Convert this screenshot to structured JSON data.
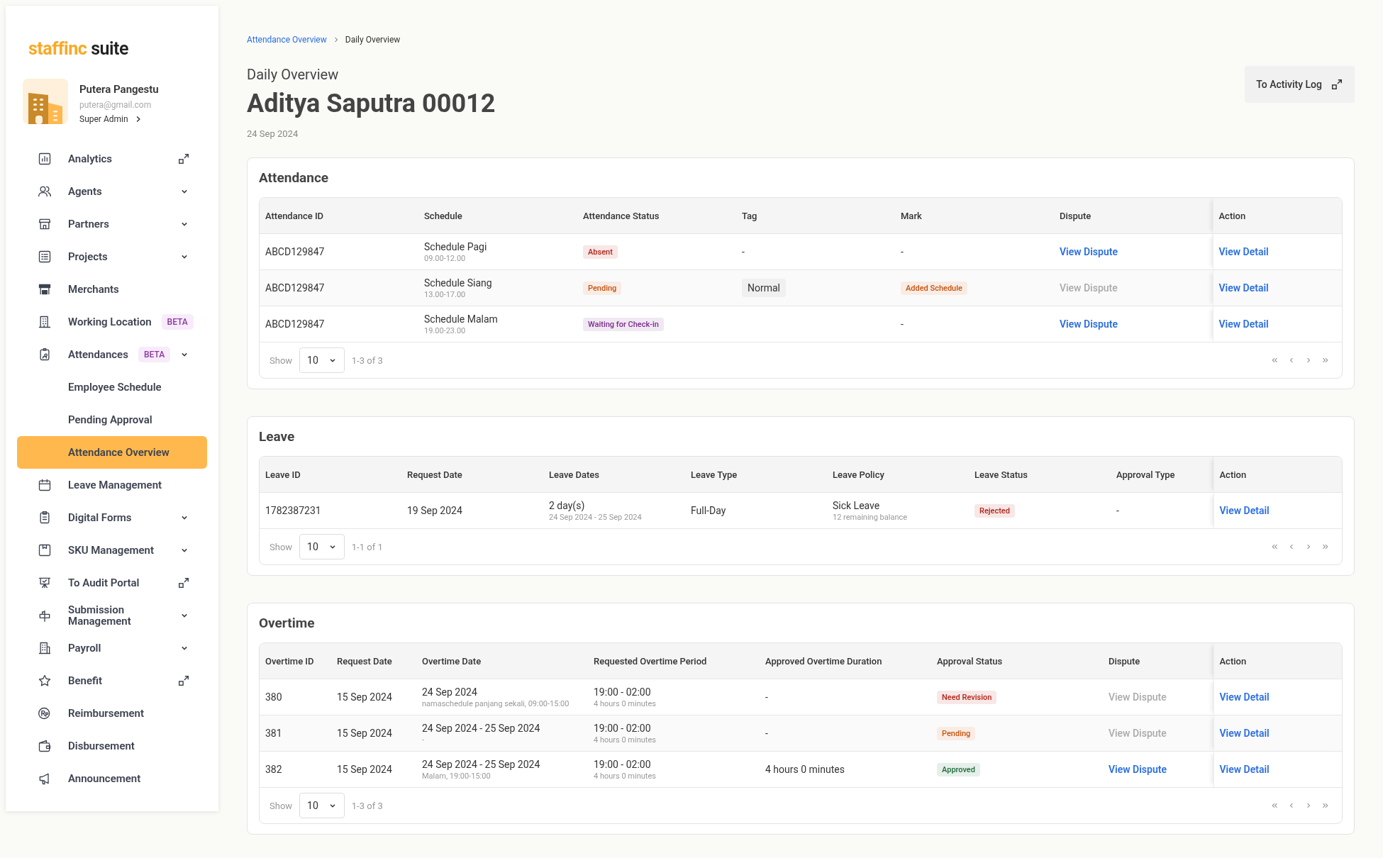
{
  "sidebar": {
    "logo": {
      "brand": "staffinc",
      "product": "suite"
    },
    "profile": {
      "name": "Putera Pangestu",
      "email": "putera@gmail.com",
      "role": "Super Admin"
    },
    "items": [
      {
        "label": "Analytics",
        "kind": "external",
        "selected": false
      },
      {
        "label": "Agents",
        "kind": "submenu",
        "selected": false
      },
      {
        "label": "Partners",
        "kind": "submenu",
        "selected": false
      },
      {
        "label": "Projects",
        "kind": "submenu",
        "selected": false
      },
      {
        "label": "Merchants",
        "kind": "page",
        "selected": false
      },
      {
        "label": "Working Location",
        "kind": "page",
        "badge": "BETA",
        "selected": false
      },
      {
        "label": "Attendances",
        "kind": "submenu",
        "badge": "BETA",
        "selected": false,
        "children": [
          {
            "label": "Employee Schedule",
            "selected": false
          },
          {
            "label": "Pending Approval",
            "selected": false
          },
          {
            "label": "Attendance Overview",
            "selected": true
          }
        ]
      },
      {
        "label": "Leave Management",
        "kind": "page",
        "selected": false
      },
      {
        "label": "Digital Forms",
        "kind": "submenu",
        "selected": false
      },
      {
        "label": "SKU Management",
        "kind": "submenu",
        "selected": false
      },
      {
        "label": "To Audit Portal",
        "kind": "external",
        "selected": false
      },
      {
        "label": "Submission Management",
        "kind": "submenu",
        "selected": false
      },
      {
        "label": "Payroll",
        "kind": "submenu",
        "selected": false
      },
      {
        "label": "Benefit",
        "kind": "external",
        "selected": false
      },
      {
        "label": "Reimbursement",
        "kind": "page",
        "selected": false
      },
      {
        "label": "Disbursement",
        "kind": "page",
        "selected": false
      },
      {
        "label": "Announcement",
        "kind": "page",
        "selected": false
      }
    ]
  },
  "breadcrumb": [
    {
      "label": "Attendance Overview",
      "current": false
    },
    {
      "label": "Daily Overview",
      "current": true
    }
  ],
  "header": {
    "subtitle": "Daily Overview",
    "title": "Aditya Saputra 00012",
    "date": "24 Sep 2024",
    "action_button": "To Activity Log"
  },
  "sections": [
    {
      "title": "Attendance",
      "columns": [
        "Attendance ID",
        "Schedule",
        "Attendance Status",
        "Tag",
        "Mark",
        "Dispute",
        "Action"
      ],
      "rows": [
        {
          "cells": [
            {
              "kind": "text",
              "text": "ABCD129847"
            },
            {
              "kind": "text",
              "text": "Schedule Pagi",
              "sub": "09.00-12.00"
            },
            {
              "kind": "badge",
              "text": "Absent",
              "color": "#b42318"
            },
            {
              "kind": "text",
              "text": "-"
            },
            {
              "kind": "text",
              "text": "-"
            },
            {
              "kind": "link",
              "text": "View Dispute",
              "disabled": false
            },
            {
              "kind": "link",
              "text": "View Detail",
              "disabled": false
            }
          ]
        },
        {
          "cells": [
            {
              "kind": "text",
              "text": "ABCD129847"
            },
            {
              "kind": "text",
              "text": "Schedule Siang",
              "sub": "13.00-17.00"
            },
            {
              "kind": "badge",
              "text": "Pending",
              "color": "#c4530f"
            },
            {
              "kind": "tag",
              "text": "Normal"
            },
            {
              "kind": "badge",
              "text": "Added Schedule",
              "color": "#c4530f"
            },
            {
              "kind": "link",
              "text": "View Dispute",
              "disabled": true
            },
            {
              "kind": "link",
              "text": "View Detail",
              "disabled": false
            }
          ]
        },
        {
          "cells": [
            {
              "kind": "text",
              "text": "ABCD129847"
            },
            {
              "kind": "text",
              "text": "Schedule Malam",
              "sub": "19.00-23.00"
            },
            {
              "kind": "badge",
              "text": "Waiting for Check-in",
              "color": "#7b2a8c"
            },
            {
              "kind": "empty"
            },
            {
              "kind": "text",
              "text": "-"
            },
            {
              "kind": "link",
              "text": "View Dispute",
              "disabled": false
            },
            {
              "kind": "link",
              "text": "View Detail",
              "disabled": false
            }
          ]
        }
      ],
      "pagination": {
        "show_label": "Show",
        "page_size": "10",
        "range": "1-3 of 3"
      }
    },
    {
      "title": "Leave",
      "columns": [
        "Leave ID",
        "Request Date",
        "Leave Dates",
        "Leave Type",
        "Leave Policy",
        "Leave Status",
        "Approval Type",
        "Action"
      ],
      "rows": [
        {
          "cells": [
            {
              "kind": "text",
              "text": "1782387231"
            },
            {
              "kind": "text",
              "text": "19 Sep 2024"
            },
            {
              "kind": "text",
              "text": "2 day(s)",
              "sub": "24 Sep 2024 - 25 Sep 2024"
            },
            {
              "kind": "text",
              "text": "Full-Day"
            },
            {
              "kind": "text",
              "text": "Sick Leave",
              "sub": "12 remaining balance"
            },
            {
              "kind": "badge",
              "text": "Rejected",
              "color": "#b42318"
            },
            {
              "kind": "text",
              "text": "-"
            },
            {
              "kind": "link",
              "text": "View Detail",
              "disabled": false
            }
          ]
        }
      ],
      "pagination": {
        "show_label": "Show",
        "page_size": "10",
        "range": "1-1 of 1"
      }
    },
    {
      "title": "Overtime",
      "columns": [
        "Overtime ID",
        "Request Date",
        "Overtime Date",
        "Requested Overtime Period",
        "Approved Overtime Duration",
        "Approval Status",
        "Dispute",
        "Action"
      ],
      "rows": [
        {
          "cells": [
            {
              "kind": "text",
              "text": "380"
            },
            {
              "kind": "text",
              "text": "15 Sep 2024"
            },
            {
              "kind": "text",
              "text": "24 Sep 2024",
              "sub": "namaschedule panjang sekali, 09:00-15:00"
            },
            {
              "kind": "text",
              "text": "19:00 - 02:00",
              "sub": "4 hours 0 minutes"
            },
            {
              "kind": "text",
              "text": "-"
            },
            {
              "kind": "badge",
              "text": "Need Revision",
              "color": "#b42318"
            },
            {
              "kind": "link",
              "text": "View Dispute",
              "disabled": true
            },
            {
              "kind": "link",
              "text": "View Detail",
              "disabled": false
            }
          ]
        },
        {
          "cells": [
            {
              "kind": "text",
              "text": "381"
            },
            {
              "kind": "text",
              "text": "15 Sep 2024"
            },
            {
              "kind": "text",
              "text": "24 Sep 2024 - 25 Sep 2024",
              "sub": "-"
            },
            {
              "kind": "text",
              "text": "19:00 - 02:00",
              "sub": "4 hours 0 minutes"
            },
            {
              "kind": "text",
              "text": "-"
            },
            {
              "kind": "badge",
              "text": "Pending",
              "color": "#c4530f"
            },
            {
              "kind": "link",
              "text": "View Dispute",
              "disabled": true
            },
            {
              "kind": "link",
              "text": "View Detail",
              "disabled": false
            }
          ]
        },
        {
          "cells": [
            {
              "kind": "text",
              "text": "382"
            },
            {
              "kind": "text",
              "text": "15 Sep 2024"
            },
            {
              "kind": "text",
              "text": "24 Sep 2024 - 25 Sep 2024",
              "sub": "Malam, 19:00-15:00"
            },
            {
              "kind": "text",
              "text": "19:00 - 02:00",
              "sub": "4 hours 0 minutes"
            },
            {
              "kind": "text",
              "text": "4 hours 0 minutes"
            },
            {
              "kind": "badge",
              "text": "Approved",
              "color": "#1e6b3a"
            },
            {
              "kind": "link",
              "text": "View Dispute",
              "disabled": false
            },
            {
              "kind": "link",
              "text": "View Detail",
              "disabled": false
            }
          ]
        }
      ],
      "pagination": {
        "show_label": "Show",
        "page_size": "10",
        "range": "1-3 of 3"
      }
    }
  ]
}
